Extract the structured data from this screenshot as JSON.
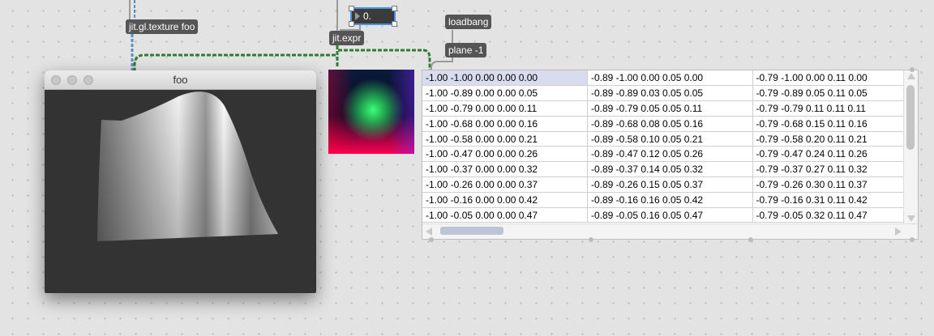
{
  "objects": {
    "texture": "jit.gl.texture foo",
    "expr": "jit.expr",
    "loadbang": "loadbang",
    "plane": "plane -1"
  },
  "number_box": {
    "value": "0."
  },
  "window": {
    "title": "foo"
  },
  "cellblock": {
    "rows": [
      [
        "-1.00 -1.00 0.00 0.00 0.00",
        "-0.89 -1.00 0.00 0.05 0.00",
        "-0.79 -1.00 0.00 0.11 0.00"
      ],
      [
        "-1.00 -0.89 0.00 0.00 0.05",
        "-0.89 -0.89 0.03 0.05 0.05",
        "-0.79 -0.89 0.05 0.11 0.05"
      ],
      [
        "-1.00 -0.79 0.00 0.00 0.11",
        "-0.89 -0.79 0.05 0.05 0.11",
        "-0.79 -0.79 0.11 0.11 0.11"
      ],
      [
        "-1.00 -0.68 0.00 0.00 0.16",
        "-0.89 -0.68 0.08 0.05 0.16",
        "-0.79 -0.68 0.15 0.11 0.16"
      ],
      [
        "-1.00 -0.58 0.00 0.00 0.21",
        "-0.89 -0.58 0.10 0.05 0.21",
        "-0.79 -0.58 0.20 0.11 0.21"
      ],
      [
        "-1.00 -0.47 0.00 0.00 0.26",
        "-0.89 -0.47 0.12 0.05 0.26",
        "-0.79 -0.47 0.24 0.11 0.26"
      ],
      [
        "-1.00 -0.37 0.00 0.00 0.32",
        "-0.89 -0.37 0.14 0.05 0.32",
        "-0.79 -0.37 0.27 0.11 0.32"
      ],
      [
        "-1.00 -0.26 0.00 0.00 0.37",
        "-0.89 -0.26 0.15 0.05 0.37",
        "-0.79 -0.26 0.30 0.11 0.37"
      ],
      [
        "-1.00 -0.16 0.00 0.00 0.42",
        "-0.89 -0.16 0.16 0.05 0.42",
        "-0.79 -0.16 0.31 0.11 0.42"
      ],
      [
        "-1.00 -0.05 0.00 0.00 0.47",
        "-0.89 -0.05 0.16 0.05 0.47",
        "-0.79 -0.05 0.32 0.11 0.47"
      ]
    ]
  },
  "colors": {
    "background": "#e3e3e3",
    "object": "#555555",
    "matrix_cable": "#2e7d32",
    "selection": "#4a90e2"
  }
}
